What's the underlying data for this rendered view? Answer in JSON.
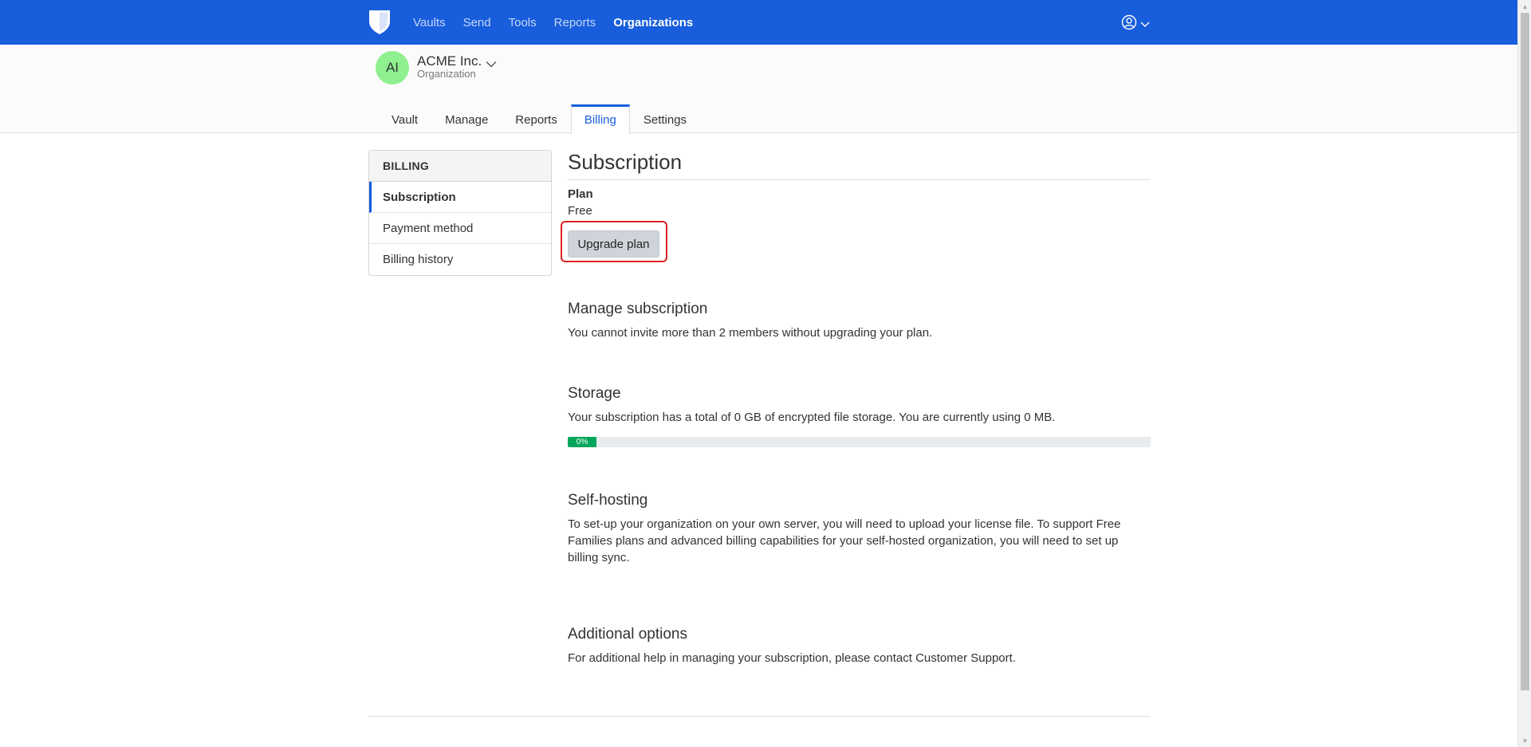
{
  "colors": {
    "primary": "#175ddc",
    "avatar_bg": "#8ef08e",
    "highlight": "#e02020",
    "progress": "#00a65a",
    "button_bg": "#ced4da"
  },
  "navbar": {
    "logo_icon": "shield-icon",
    "links": [
      {
        "label": "Vaults",
        "active": false
      },
      {
        "label": "Send",
        "active": false
      },
      {
        "label": "Tools",
        "active": false
      },
      {
        "label": "Reports",
        "active": false
      },
      {
        "label": "Organizations",
        "active": true
      }
    ],
    "account_icon": "user-circle-icon"
  },
  "organization": {
    "initials": "AI",
    "name": "ACME Inc.",
    "type": "Organization"
  },
  "tabs": [
    {
      "label": "Vault",
      "active": false
    },
    {
      "label": "Manage",
      "active": false
    },
    {
      "label": "Reports",
      "active": false
    },
    {
      "label": "Billing",
      "active": true
    },
    {
      "label": "Settings",
      "active": false
    }
  ],
  "sidebar": {
    "heading": "BILLING",
    "items": [
      {
        "label": "Subscription",
        "active": true
      },
      {
        "label": "Payment method",
        "active": false
      },
      {
        "label": "Billing history",
        "active": false
      }
    ]
  },
  "main": {
    "title": "Subscription",
    "plan_label": "Plan",
    "plan_value": "Free",
    "upgrade_button": "Upgrade plan",
    "manage": {
      "title": "Manage subscription",
      "text": "You cannot invite more than 2 members without upgrading your plan."
    },
    "storage": {
      "title": "Storage",
      "text": "Your subscription has a total of 0 GB of encrypted file storage. You are currently using 0 MB.",
      "progress_label": "0%",
      "progress_percent": 0
    },
    "self_hosting": {
      "title": "Self-hosting",
      "text": "To set-up your organization on your own server, you will need to upload your license file. To support Free Families plans and advanced billing capabilities for your self-hosted organization, you will need to set up billing sync."
    },
    "additional": {
      "title": "Additional options",
      "text": "For additional help in managing your subscription, please contact Customer Support."
    }
  }
}
